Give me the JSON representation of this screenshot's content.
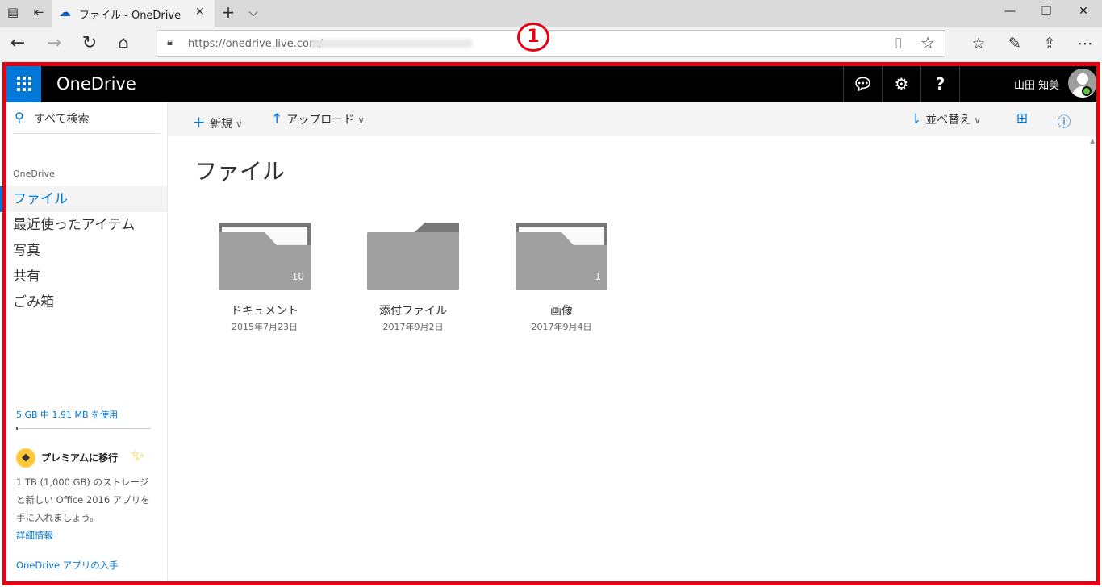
{
  "browser": {
    "tab_title": "ファイル - OneDrive",
    "address_url": "https://onedrive.live.com/",
    "callout_number": "1"
  },
  "header": {
    "brand": "OneDrive",
    "user_name": "山田 知美"
  },
  "sidebar": {
    "search_label": "すべて検索",
    "section_heading": "OneDrive",
    "items": [
      {
        "label": "ファイル"
      },
      {
        "label": "最近使ったアイテム"
      },
      {
        "label": "写真"
      },
      {
        "label": "共有"
      },
      {
        "label": "ごみ箱"
      }
    ],
    "quota_text": "5 GB 中 1.91 MB を使用",
    "quota_used_fraction": 0.0004,
    "premium_title": "プレミアムに移行",
    "premium_desc": "1 TB (1,000 GB) のストレージと新しい Office 2016 アプリを手に入れましょう。",
    "more_info": "詳細情報",
    "get_app": "OneDrive アプリの入手"
  },
  "commandbar": {
    "new_label": "新規",
    "upload_label": "アップロード",
    "sort_label": "並べ替え"
  },
  "main": {
    "title": "ファイル",
    "folders": [
      {
        "name": "ドキュメント",
        "date": "2015年7月23日",
        "count": "10"
      },
      {
        "name": "添付ファイル",
        "date": "2017年9月2日",
        "count": ""
      },
      {
        "name": "画像",
        "date": "2017年9月4日",
        "count": "1"
      }
    ]
  },
  "colors": {
    "accent": "#0078d7",
    "header_bg": "#000000",
    "highlight_frame": "#e60012",
    "folder": "#a0a0a0"
  }
}
